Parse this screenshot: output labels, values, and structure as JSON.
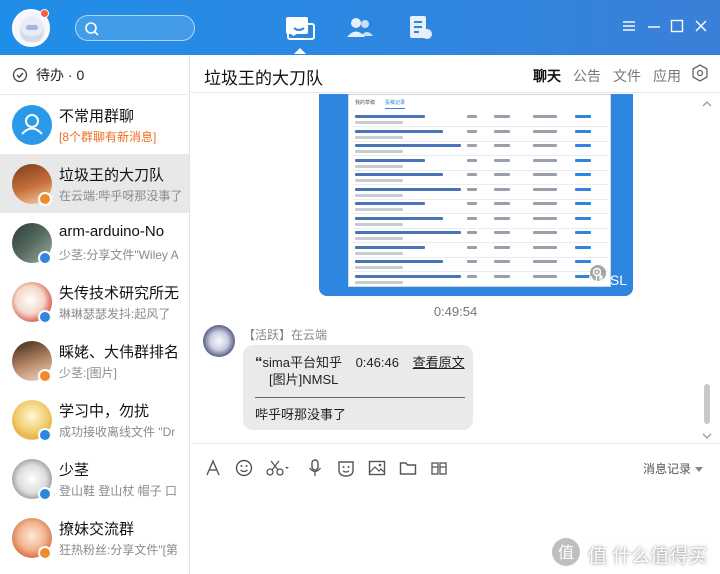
{
  "window": {
    "top_tabs": [
      "message-tab",
      "contacts-tab",
      "documents-tab"
    ],
    "controls": [
      "menu-icon",
      "minimize-icon",
      "maximize-icon",
      "close-icon"
    ]
  },
  "sidebar": {
    "todo_label": "待办 · 0",
    "conversations": [
      {
        "name": "不常用群聊",
        "preview": "[8个群聊有新消息]",
        "highlight": true
      },
      {
        "name": "垃圾王的大刀队",
        "preview": "在云端:哔乎呀那没事了"
      },
      {
        "name": "arm-arduino-No",
        "preview": "少茎:分享文件\"Wiley A"
      },
      {
        "name": "失传技术研究所无",
        "preview": "琳琳瑟瑟发抖:起风了"
      },
      {
        "name": "睬姥、大伟群排名",
        "preview": "少茎:[图片]"
      },
      {
        "name": "学习中，勿扰",
        "preview": "成功接收离线文件 \"Dr"
      },
      {
        "name": "少茎",
        "preview": "登山鞋 登山杖 帽子 口"
      },
      {
        "name": "撩妹交流群",
        "preview": "狂热粉丝:分享文件\"[第"
      }
    ]
  },
  "header": {
    "title": "垃圾王的大刀队",
    "tabs": [
      "聊天",
      "公告",
      "文件",
      "应用"
    ],
    "active_tab": "聊天"
  },
  "chat": {
    "image_caption": "NMSL",
    "screenshot_tabs": [
      "我的草稿",
      "投稿记录"
    ],
    "timestamp": "0:49:54",
    "sender_line": "【活跃】在云端",
    "quote_prefix": "“",
    "quote_sender": "sima平台知乎",
    "quote_time": "0:46:46",
    "quote_link": "查看原文",
    "quote_content": "[图片]NMSL",
    "reply_text": "哔乎呀那没事了"
  },
  "input": {
    "toolbar": [
      "font-icon",
      "emoji-icon",
      "scissors-icon",
      "voice-icon",
      "sticker-icon",
      "image-icon",
      "folder-icon",
      "more-icon"
    ],
    "history_label": "消息记录"
  },
  "watermark": {
    "text": "值 什么值得买"
  },
  "colors": {
    "accent": "#2f86e0",
    "highlight": "#f06d20",
    "bubble": "#e9eaec"
  }
}
